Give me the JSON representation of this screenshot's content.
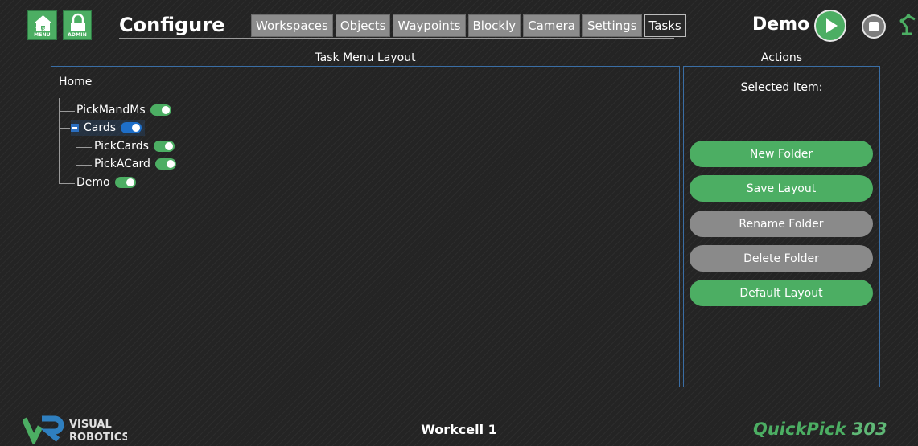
{
  "header": {
    "task_menu_label": "TASK MENU",
    "admin_label": "ADMIN",
    "title": "Configure",
    "tabs": [
      {
        "label": "Workspaces"
      },
      {
        "label": "Objects"
      },
      {
        "label": "Waypoints"
      },
      {
        "label": "Blockly"
      },
      {
        "label": "Camera"
      },
      {
        "label": "Settings"
      },
      {
        "label": "Tasks",
        "active": true
      }
    ],
    "current_task": "Demo"
  },
  "layout_panel": {
    "title": "Task Menu Layout",
    "root": "Home",
    "nodes": [
      {
        "label": "PickMandMs",
        "enabled": true
      },
      {
        "label": "Cards",
        "enabled": true,
        "expanded": true
      },
      {
        "label": "PickCards",
        "enabled": true
      },
      {
        "label": "PickACard",
        "enabled": true
      },
      {
        "label": "Demo",
        "enabled": true
      }
    ]
  },
  "actions_panel": {
    "title": "Actions",
    "selected_item_label": "Selected Item:",
    "buttons": [
      {
        "label": "New Folder",
        "color": "#4cae63"
      },
      {
        "label": "Save Layout",
        "color": "#4cae63"
      },
      {
        "label": "Rename Folder",
        "color": "#8a8a8a"
      },
      {
        "label": "Delete Folder",
        "color": "#8a8a8a"
      },
      {
        "label": "Default Layout",
        "color": "#4cae63"
      }
    ]
  },
  "footer": {
    "logo_line1": "VISUAL",
    "logo_line2": "ROBOTICS",
    "workcell": "Workcell 1",
    "product_a": "QuickPick",
    "product_b": "303"
  },
  "colors": {
    "accent_green": "#4cae63",
    "panel_border": "#3a6ea5",
    "toggle_blue": "#1e6fc9"
  }
}
